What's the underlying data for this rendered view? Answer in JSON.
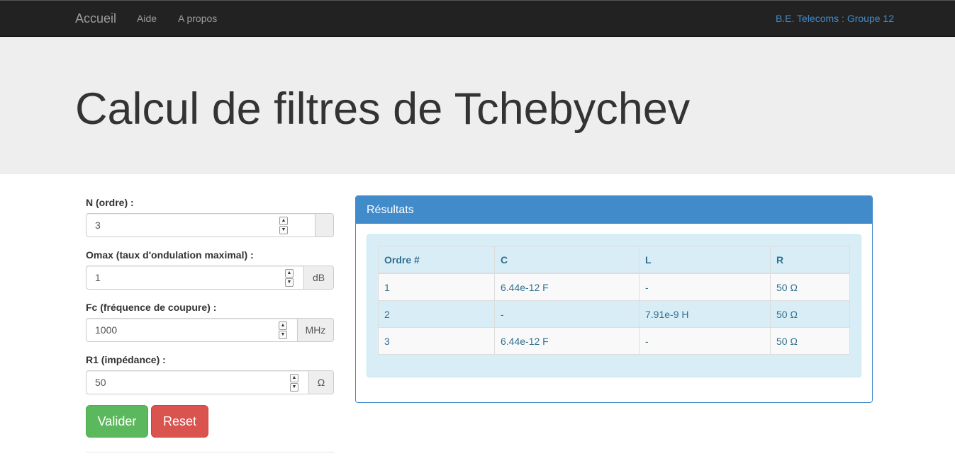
{
  "nav": {
    "brand": "Accueil",
    "links": [
      "Aide",
      "A propos"
    ],
    "right": "B.E. Telecoms : Groupe 12"
  },
  "header": {
    "title": "Calcul de filtres de Tchebychev"
  },
  "form": {
    "fields": [
      {
        "label": "N (ordre) :",
        "value": "3",
        "addon": ""
      },
      {
        "label": "Omax (taux d'ondulation maximal) :",
        "value": "1",
        "addon": "dB"
      },
      {
        "label": "Fc (fréquence de coupure) :",
        "value": "1000",
        "addon": "MHz"
      },
      {
        "label": "R1 (impédance) :",
        "value": "50",
        "addon": "Ω"
      }
    ],
    "valider_label": "Valider",
    "reset_label": "Reset"
  },
  "results": {
    "title": "Résultats",
    "columns": [
      "Ordre #",
      "C",
      "L",
      "R"
    ],
    "rows": [
      [
        "1",
        "6.44e-12 F",
        "-",
        "50 Ω"
      ],
      [
        "2",
        "-",
        "7.91e-9 H",
        "50 Ω"
      ],
      [
        "3",
        "6.44e-12 F",
        "-",
        "50 Ω"
      ]
    ]
  },
  "colors": {
    "navbar": "#222222",
    "jumbotron": "#eeeeee",
    "primary": "#428bca",
    "success": "#5cb85c",
    "danger": "#d9534f",
    "info_bg": "#d9edf7",
    "info_text": "#31708f"
  },
  "icons": {
    "spinner": "number-spinner-icon"
  }
}
